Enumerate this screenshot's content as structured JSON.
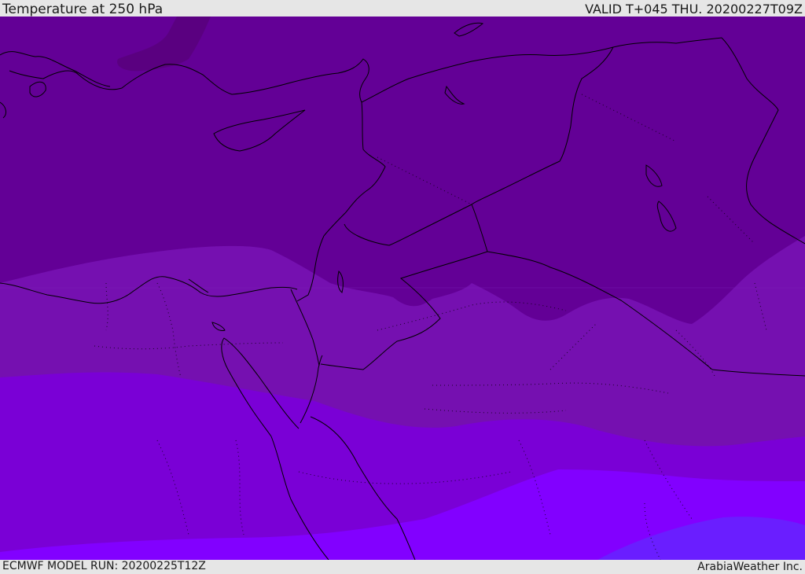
{
  "header": {
    "title": "Temperature at 250 hPa",
    "valid": "VALID T+045 THU. 20200227T09Z"
  },
  "footer": {
    "model_run": "ECMWF MODEL RUN: 20200225T12Z",
    "credit": "ArabiaWeather Inc."
  },
  "map": {
    "field": "temperature",
    "level": "250 hPa",
    "region": "Eastern Mediterranean / Levant / Egypt",
    "colors": {
      "band_darkest": "#5a0080",
      "band_dark": "#630096",
      "band_mid": "#7510b0",
      "band_light": "#7a00d6",
      "band_bright": "#8200ff",
      "band_blue": "#6a1eff",
      "coastline": "#000000"
    }
  }
}
